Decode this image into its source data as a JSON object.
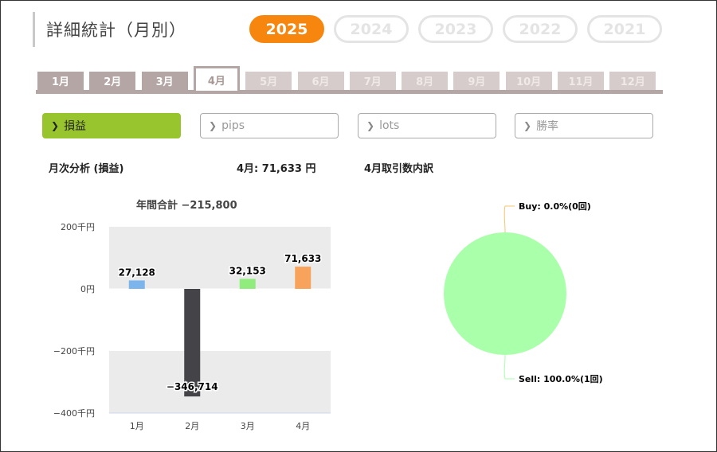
{
  "title": "詳細統計（月別）",
  "years": [
    {
      "label": "2025",
      "active": true
    },
    {
      "label": "2024",
      "active": false
    },
    {
      "label": "2023",
      "active": false
    },
    {
      "label": "2022",
      "active": false
    },
    {
      "label": "2021",
      "active": false
    }
  ],
  "months": [
    {
      "label": "1月",
      "state": "enabled"
    },
    {
      "label": "2月",
      "state": "enabled"
    },
    {
      "label": "3月",
      "state": "enabled"
    },
    {
      "label": "4月",
      "state": "active"
    },
    {
      "label": "5月",
      "state": "disabled"
    },
    {
      "label": "6月",
      "state": "disabled"
    },
    {
      "label": "7月",
      "state": "disabled"
    },
    {
      "label": "8月",
      "state": "disabled"
    },
    {
      "label": "9月",
      "state": "disabled"
    },
    {
      "label": "10月",
      "state": "disabled"
    },
    {
      "label": "11月",
      "state": "disabled"
    },
    {
      "label": "12月",
      "state": "disabled"
    }
  ],
  "metrics": [
    {
      "label": "損益",
      "active": true
    },
    {
      "label": "pips",
      "active": false
    },
    {
      "label": "lots",
      "active": false
    },
    {
      "label": "勝率",
      "active": false
    }
  ],
  "headings": {
    "analysis": "月次分析 (損益)",
    "month_value": "4月:  71,633 円",
    "breakdown": "4月取引数内訳"
  },
  "colors": {
    "accent_orange": "#f7860f",
    "metric_active": "#98c52d",
    "tab_bg": "#b4a6a4"
  },
  "chart_data": [
    {
      "type": "bar",
      "title": "年間合計 −215,800",
      "categories": [
        "1月",
        "2月",
        "3月",
        "4月"
      ],
      "values": [
        27128,
        -346714,
        32153,
        71633
      ],
      "value_labels": [
        "27,128",
        "−346,714",
        "32,153",
        "71,633"
      ],
      "bar_colors": [
        "#7cb5ec",
        "#434348",
        "#90ed7d",
        "#f7a35c"
      ],
      "ylim": [
        -400000,
        200000
      ],
      "yticks": [
        {
          "value": 200000,
          "label": "200千円"
        },
        {
          "value": 0,
          "label": "0円"
        },
        {
          "value": -200000,
          "label": "−200千円"
        },
        {
          "value": -400000,
          "label": "−400千円"
        }
      ],
      "grid": "alternating bands"
    },
    {
      "type": "pie",
      "slices": [
        {
          "name": "Buy",
          "value": 0.0,
          "count": 0,
          "label": "Buy: 0.0%(0回)",
          "color": "#7cb5ec"
        },
        {
          "name": "Sell",
          "value": 100.0,
          "count": 1,
          "label": "Sell: 100.0%(1回)",
          "color": "#aaffaa"
        }
      ]
    }
  ]
}
